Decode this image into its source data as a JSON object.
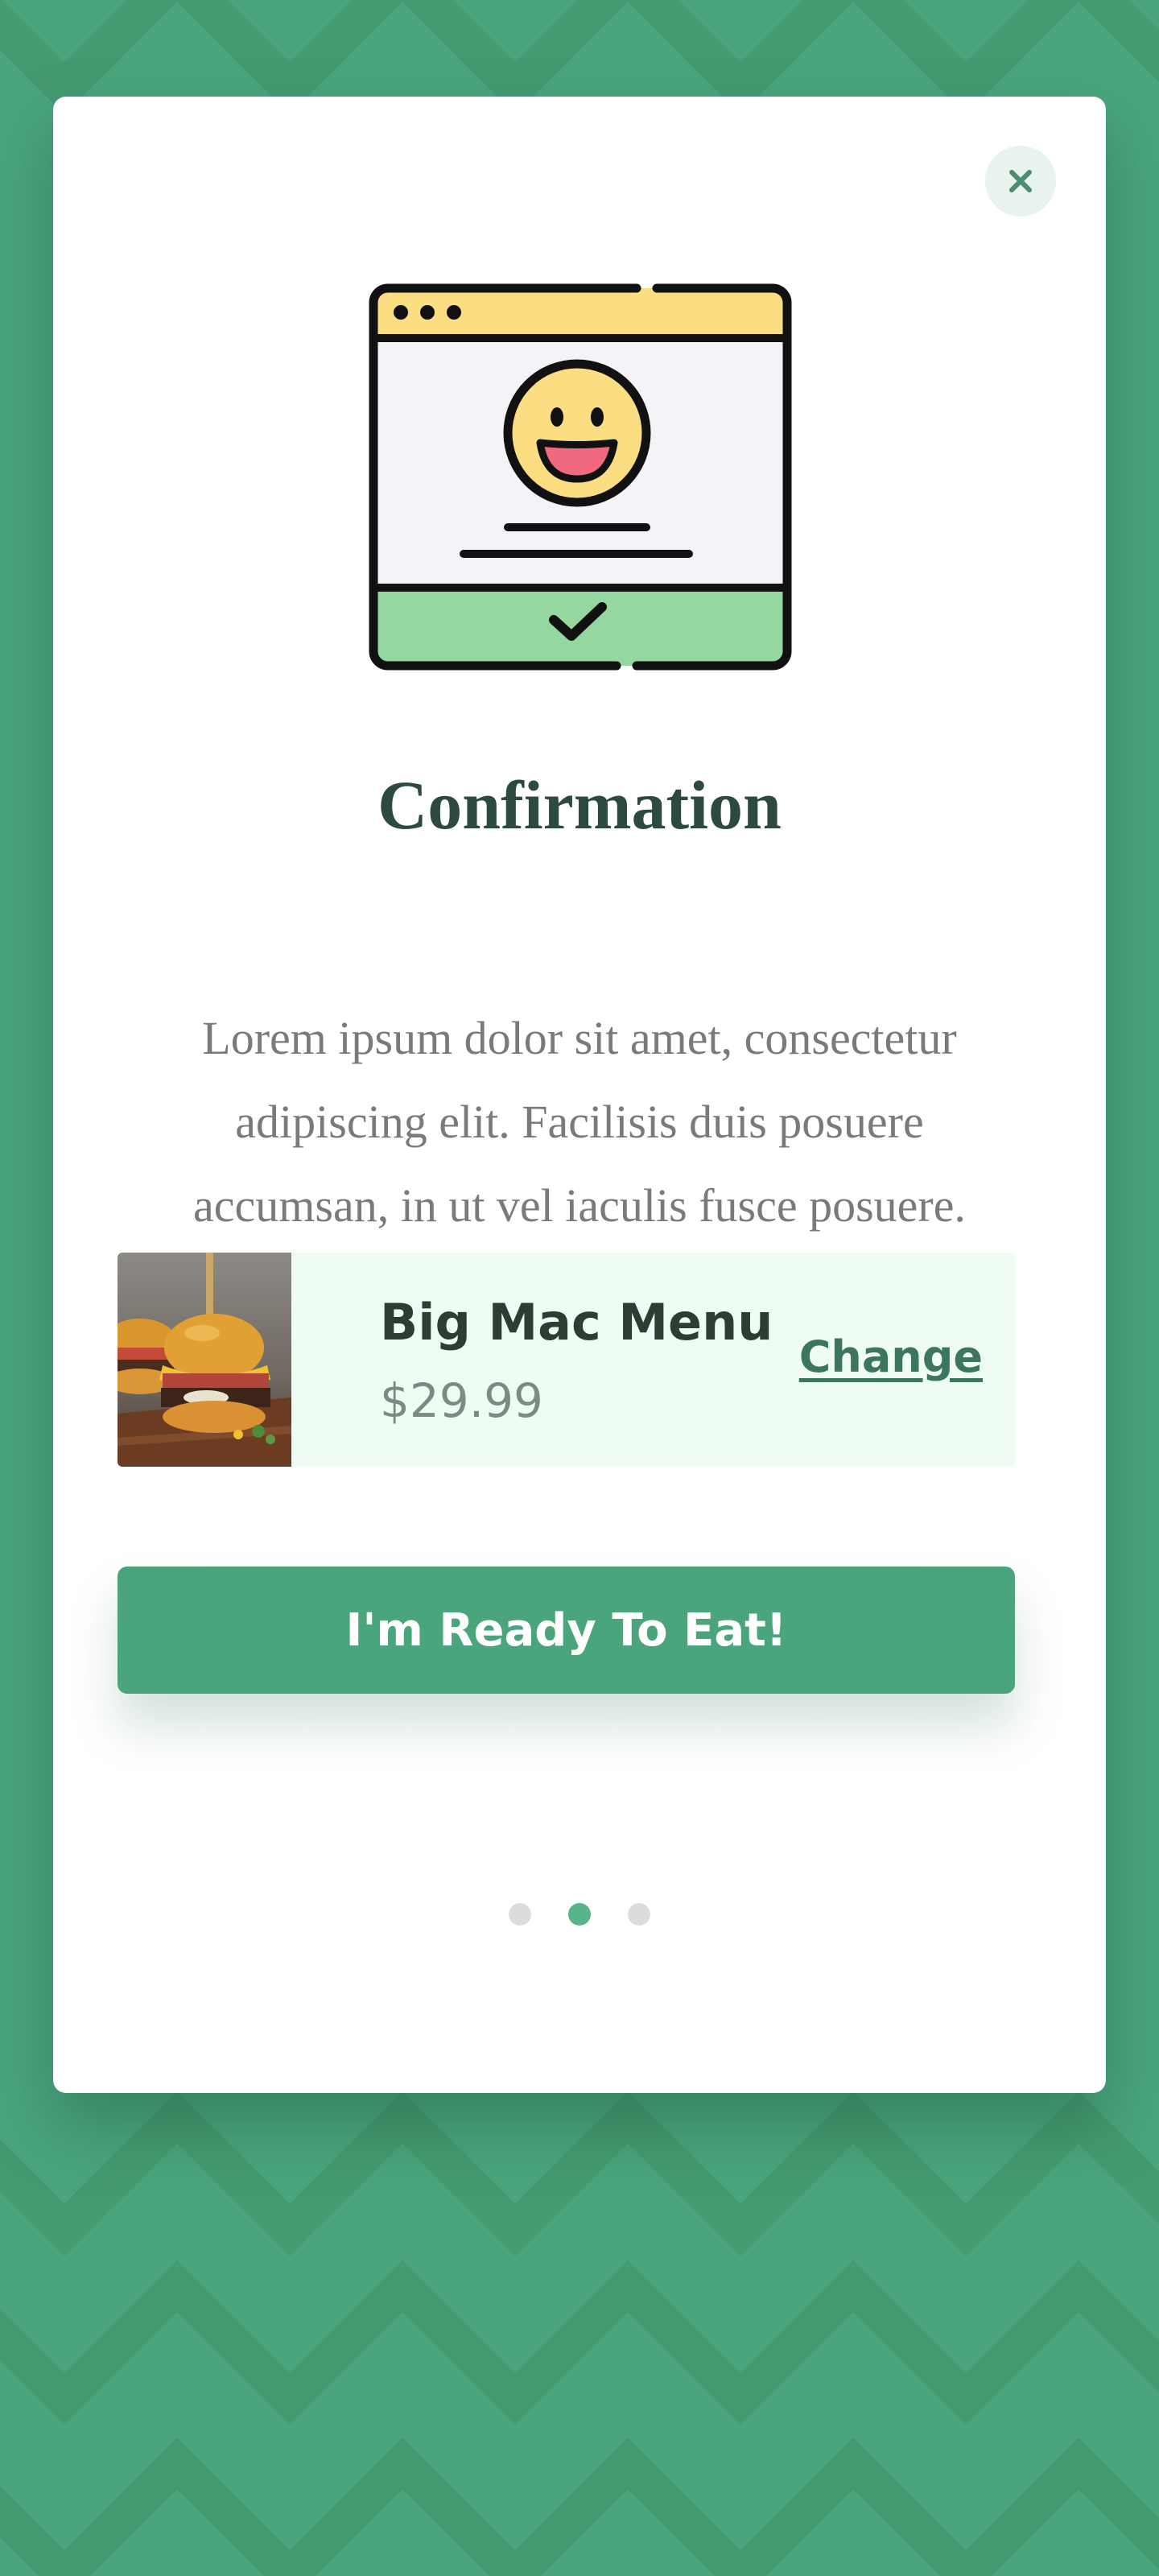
{
  "modal": {
    "title": "Confirmation",
    "description": "Lorem ipsum dolor sit amet, consectetur adipiscing elit. Facilisis duis posuere accumsan, in ut vel iaculis fusce posuere.",
    "close_icon": "close-icon",
    "illustration_icon": "smiley-window-check-icon"
  },
  "order": {
    "item_name": "Big Mac Menu",
    "price": "$29.99",
    "change_label": "Change",
    "thumbnail": "burger-image"
  },
  "cta": {
    "label": "I'm Ready To Eat!"
  },
  "pagination": {
    "total": 3,
    "active_index": 1
  },
  "colors": {
    "background": "#4aa57c",
    "accent": "#4aa57c",
    "title": "#2c4a3d",
    "order_bg": "#effcf4",
    "dot_active": "#58b48a",
    "dot_inactive": "#dcdcdc"
  }
}
